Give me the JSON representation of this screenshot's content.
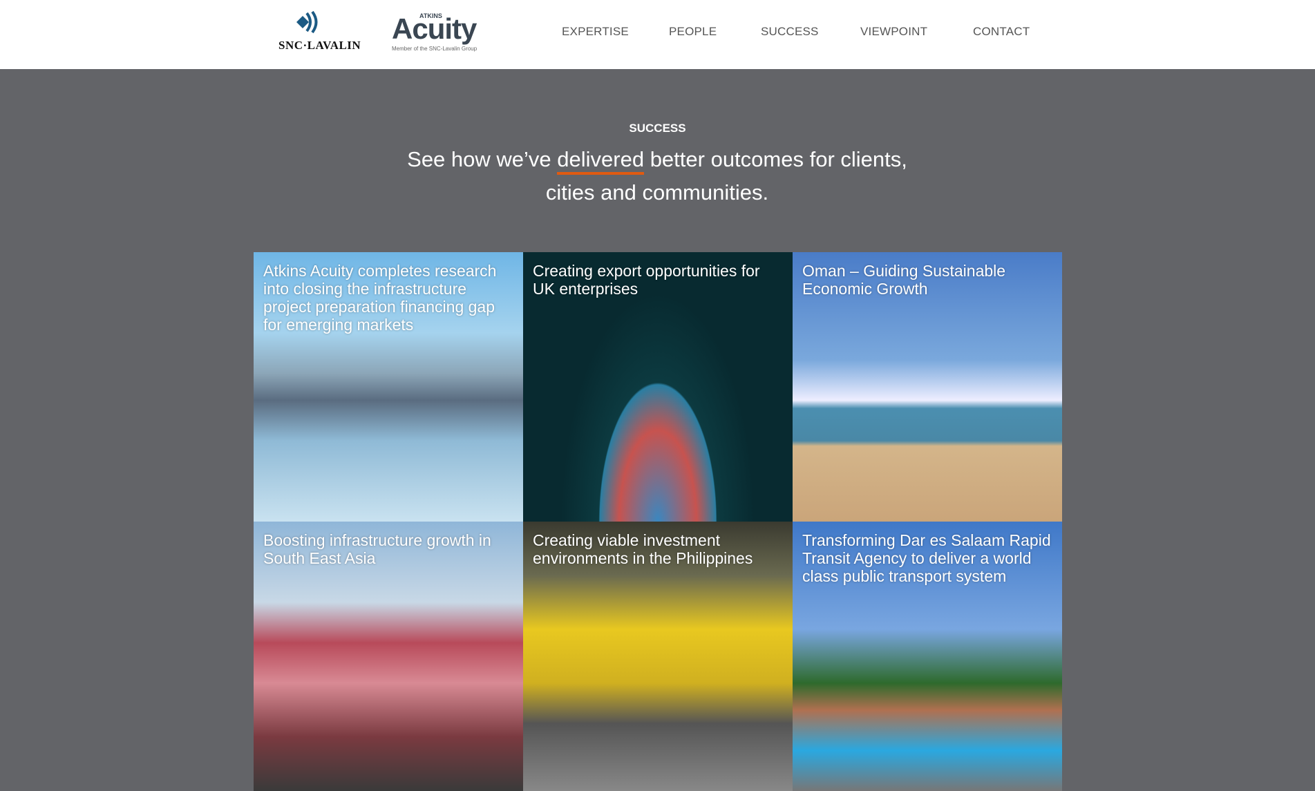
{
  "header": {
    "logo_snc": "SNC·LAVALIN",
    "logo_acuity_small": "ATKINS",
    "logo_acuity": "Acuity",
    "logo_acuity_tagline": "Member of the SNC-Lavalin Group",
    "nav": [
      "EXPERTISE",
      "PEOPLE",
      "SUCCESS",
      "VIEWPOINT",
      "CONTACT"
    ]
  },
  "intro": {
    "label": "SUCCESS",
    "headline_pre": "See how we’ve ",
    "headline_underlined": "delivered",
    "headline_post": " better outcomes for clients, cities and communities.",
    "accent_color": "#e05a10"
  },
  "cases": [
    {
      "title": "Atkins Acuity completes research into closing the infrastructure project preparation financing gap for emerging markets"
    },
    {
      "title": "Creating export opportunities for UK enterprises"
    },
    {
      "title": "Oman – Guiding Sustainable Economic Growth"
    },
    {
      "title": "Boosting infrastructure growth in South East Asia"
    },
    {
      "title": "Creating viable investment environments in the Philippines"
    },
    {
      "title": "Transforming Dar es Salaam Rapid Transit Agency to deliver a world class public transport system"
    }
  ]
}
